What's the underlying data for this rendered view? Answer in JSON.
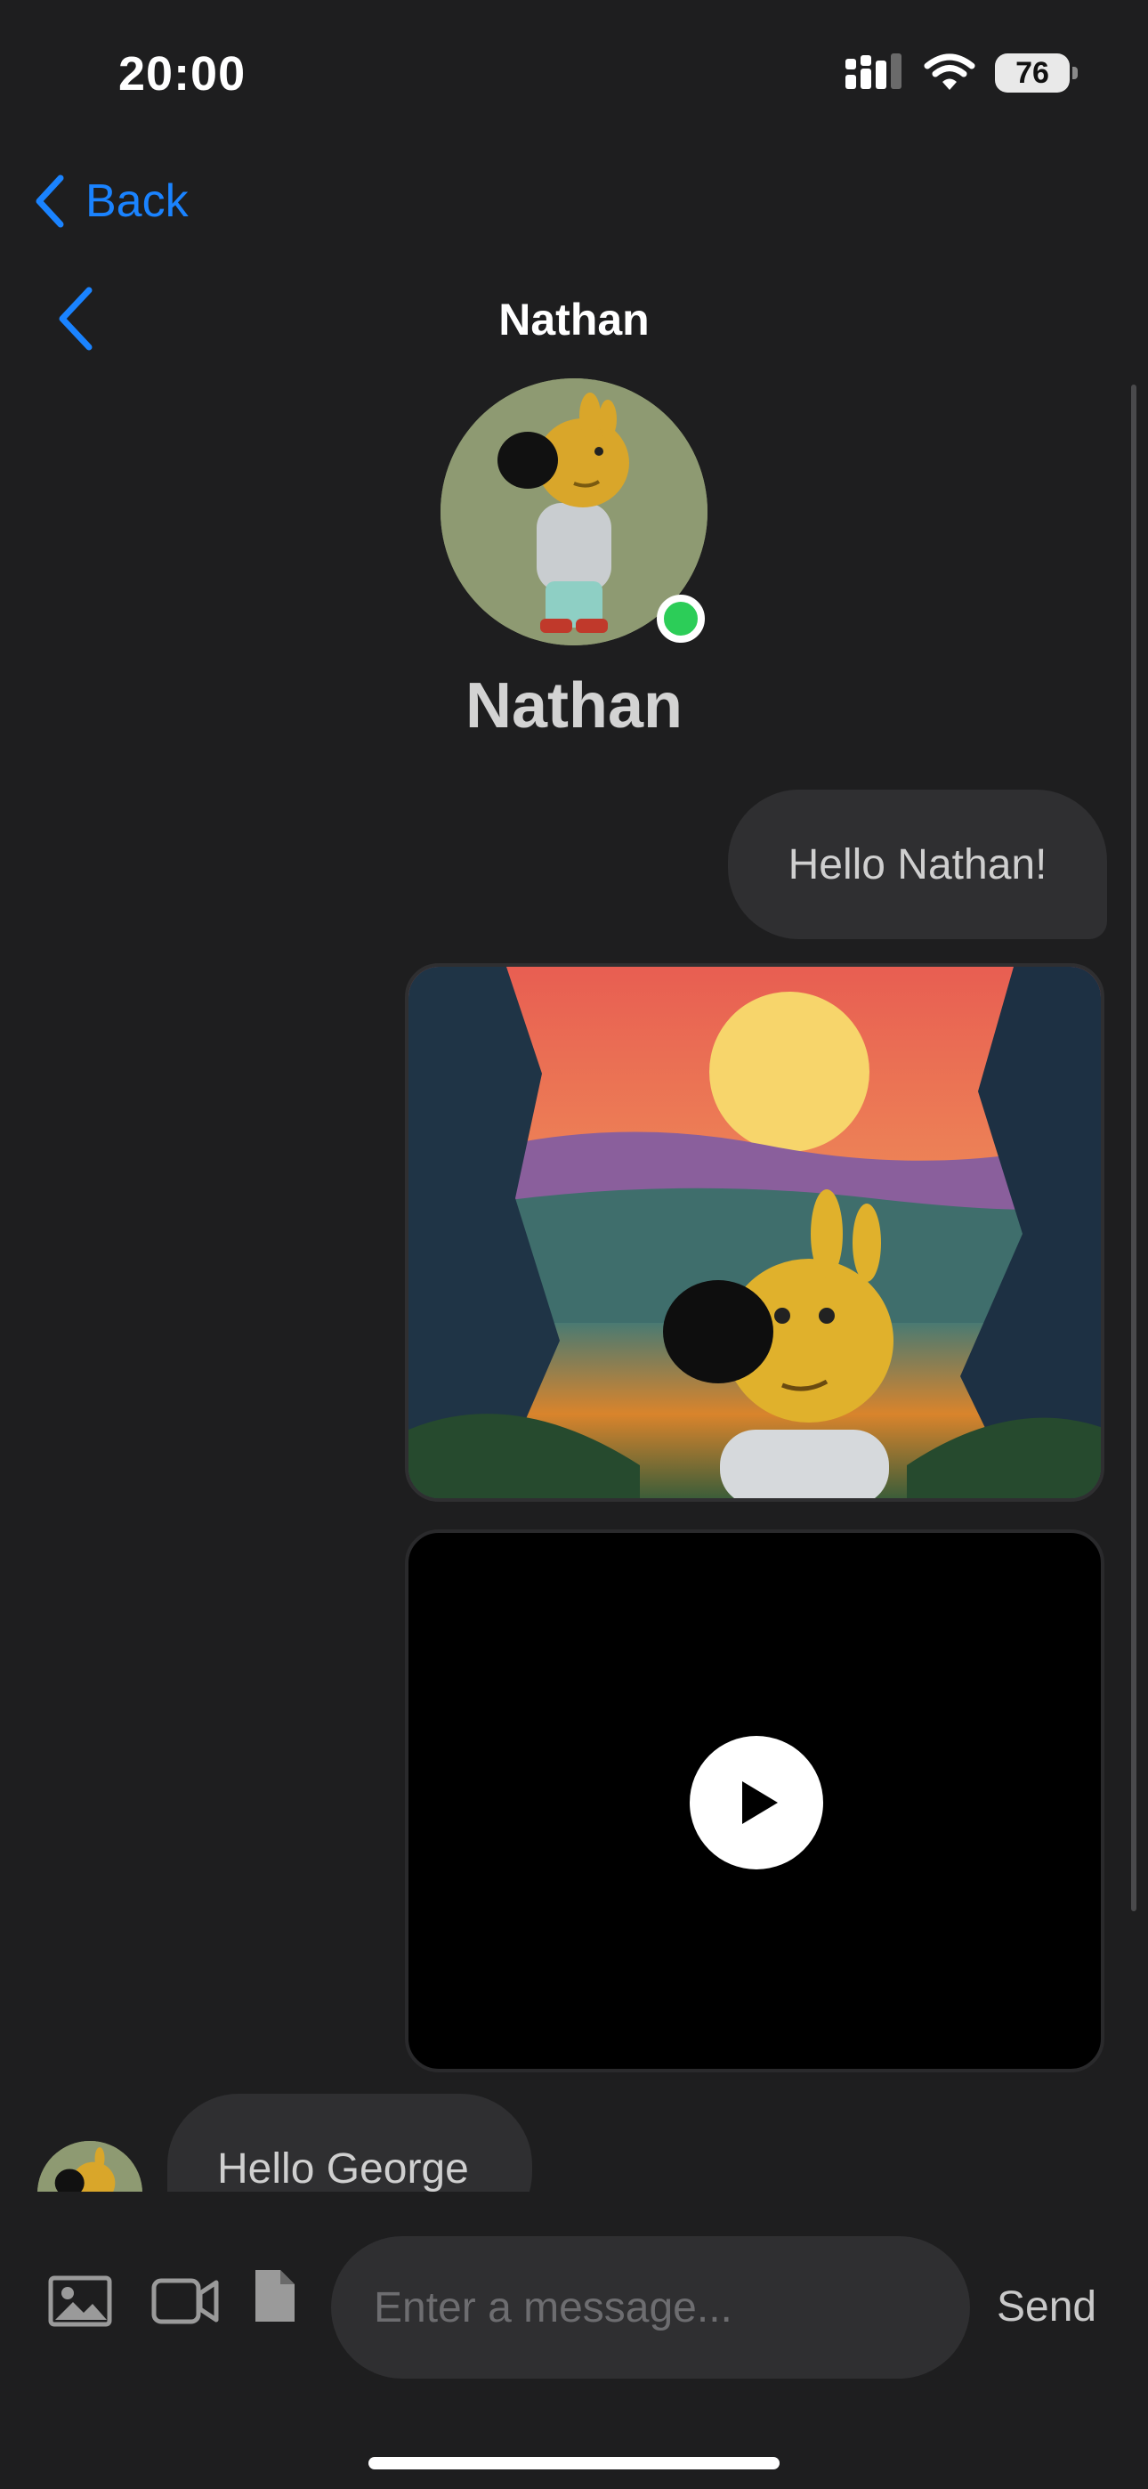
{
  "status_bar": {
    "time": "20:00",
    "battery": "76"
  },
  "nav": {
    "back_label": "Back"
  },
  "header": {
    "title": "Nathan"
  },
  "profile": {
    "name": "Nathan",
    "online": true
  },
  "messages": [
    {
      "direction": "outgoing",
      "type": "text",
      "text": "Hello Nathan!"
    },
    {
      "direction": "outgoing",
      "type": "image"
    },
    {
      "direction": "outgoing",
      "type": "video"
    },
    {
      "direction": "incoming",
      "type": "text",
      "text": "Hello George"
    }
  ],
  "composer": {
    "placeholder": "Enter a message...",
    "send_label": "Send"
  },
  "colors": {
    "accent": "#1a83ff",
    "background": "#1e1e1f",
    "bubble": "#2f2f31",
    "online": "#2ccd58"
  },
  "icons": [
    "signal-icon",
    "wifi-icon",
    "battery-icon",
    "chevron-left-icon",
    "image-icon",
    "video-camera-icon",
    "file-icon",
    "play-icon"
  ]
}
